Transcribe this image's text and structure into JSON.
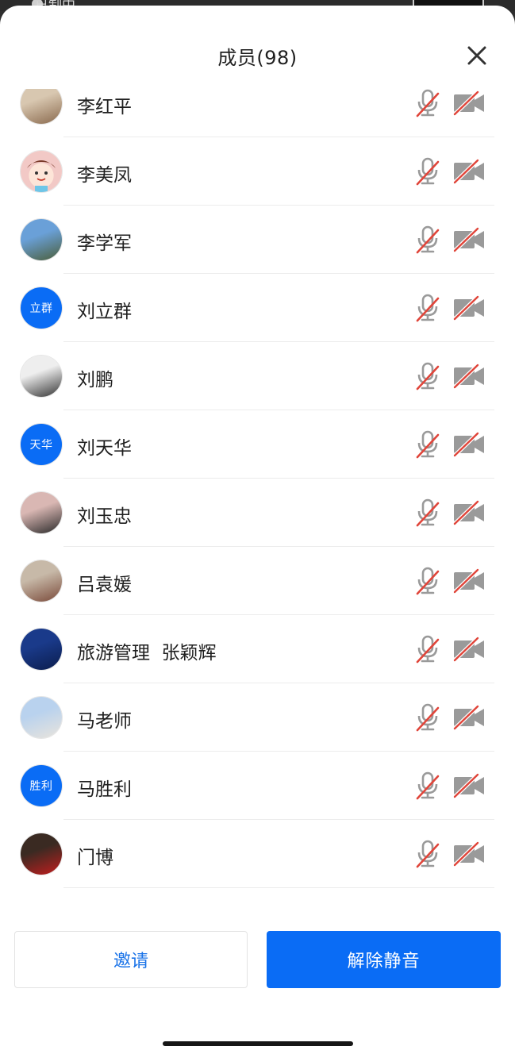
{
  "status_bar": {
    "label": "已制中"
  },
  "header": {
    "title": "成员(98)"
  },
  "members": [
    {
      "name": "李红平",
      "avatar_type": "photo",
      "avatar_colors": [
        "#d8c7b0",
        "#8a6a4e"
      ]
    },
    {
      "name": "李美凤",
      "avatar_type": "cartoon",
      "avatar_colors": [
        "#f2c9c6",
        "#6ec6e8"
      ]
    },
    {
      "name": "李学军",
      "avatar_type": "photo",
      "avatar_colors": [
        "#6aa0d8",
        "#4b5e3a"
      ]
    },
    {
      "name": "刘立群",
      "avatar_type": "initials",
      "initials": "立群",
      "avatar_colors": [
        "#0a6cf5",
        "#0a6cf5"
      ]
    },
    {
      "name": "刘鹏",
      "avatar_type": "photo",
      "avatar_colors": [
        "#eeeeee",
        "#333333"
      ]
    },
    {
      "name": "刘天华",
      "avatar_type": "initials",
      "initials": "天华",
      "avatar_colors": [
        "#0a6cf5",
        "#0a6cf5"
      ]
    },
    {
      "name": "刘玉忠",
      "avatar_type": "photo",
      "avatar_colors": [
        "#d9b7b3",
        "#2a2a2a"
      ]
    },
    {
      "name": "吕袁媛",
      "avatar_type": "photo",
      "avatar_colors": [
        "#c7b9a8",
        "#7a4a3a"
      ]
    },
    {
      "name": "旅游管理  张颖辉",
      "avatar_type": "photo",
      "avatar_colors": [
        "#1a3a8a",
        "#0b1d4d"
      ]
    },
    {
      "name": "马老师",
      "avatar_type": "photo",
      "avatar_colors": [
        "#b9d2ee",
        "#e9e4dc"
      ]
    },
    {
      "name": "马胜利",
      "avatar_type": "initials",
      "initials": "胜利",
      "avatar_colors": [
        "#0a6cf5",
        "#0a6cf5"
      ]
    },
    {
      "name": "门博",
      "avatar_type": "photo",
      "avatar_colors": [
        "#3a2a22",
        "#c21e1e"
      ]
    }
  ],
  "footer": {
    "invite_label": "邀请",
    "unmute_label": "解除静音"
  },
  "colors": {
    "accent": "#0a6cf5",
    "muted_red": "#e0453a",
    "icon_gray": "#9a9a9a"
  }
}
